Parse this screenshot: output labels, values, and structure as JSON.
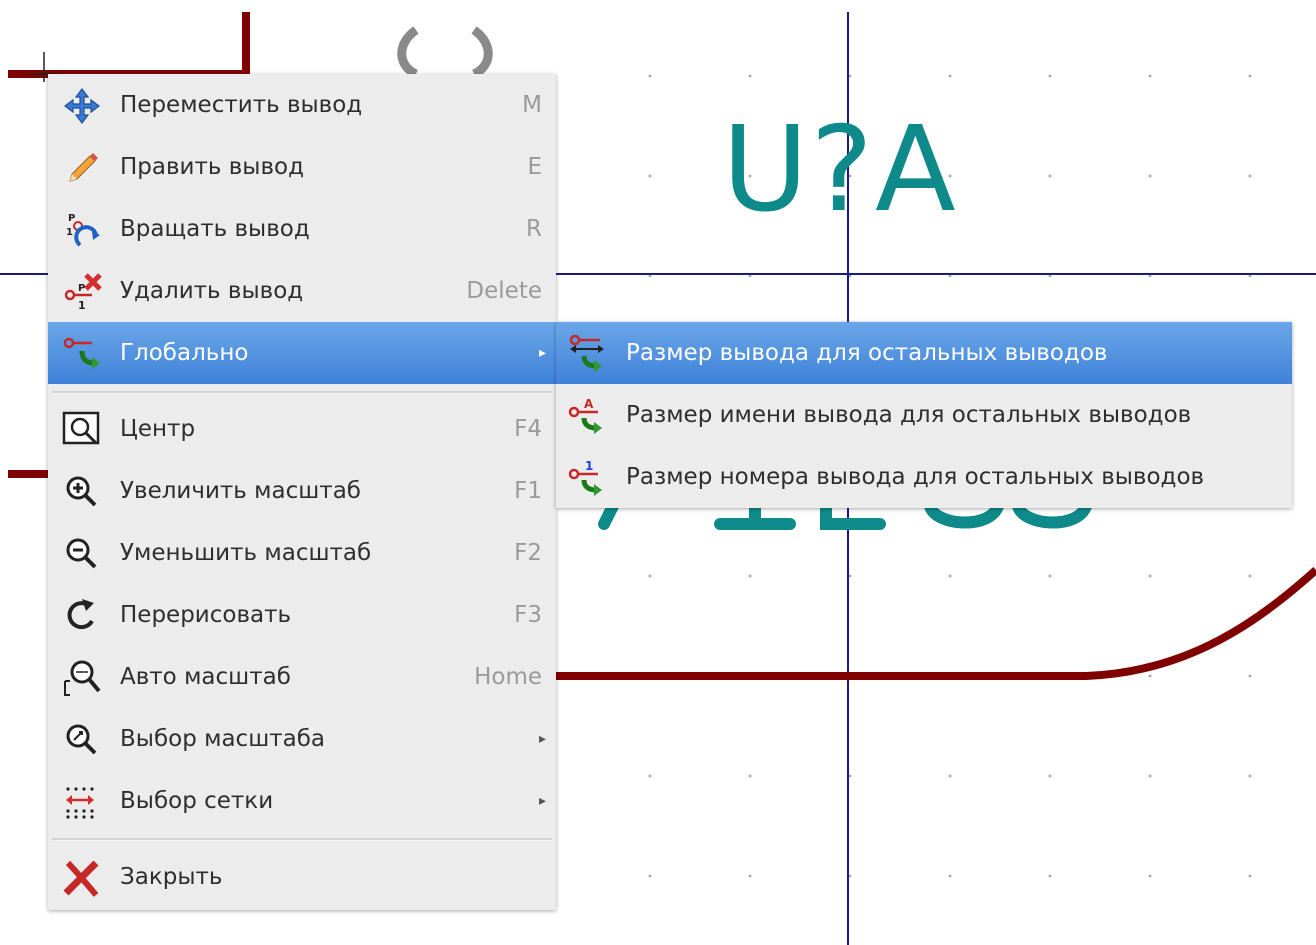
{
  "editor": {
    "reference_text": "U?A",
    "colors": {
      "grid_line": "#1a1a8c",
      "wire": "#800000",
      "ref_text": "#0f8a8a",
      "menu_bg": "#ececec",
      "highlight": "#4a8fe0"
    }
  },
  "context_menu": {
    "items": [
      {
        "label": "Переместить вывод",
        "shortcut": "M",
        "icon": "move-icon"
      },
      {
        "label": "Править вывод",
        "shortcut": "E",
        "icon": "pencil-icon"
      },
      {
        "label": "Вращать вывод",
        "shortcut": "R",
        "icon": "rotate-pin-icon"
      },
      {
        "label": "Удалить вывод",
        "shortcut": "Delete",
        "icon": "delete-pin-icon"
      },
      {
        "label": "Глобально",
        "shortcut": "",
        "icon": "global-pin-icon",
        "submenu": true,
        "active": true
      },
      {
        "label": "Центр",
        "shortcut": "F4",
        "icon": "zoom-center-icon"
      },
      {
        "label": "Увеличить масштаб",
        "shortcut": "F1",
        "icon": "zoom-in-icon"
      },
      {
        "label": "Уменьшить масштаб",
        "shortcut": "F2",
        "icon": "zoom-out-icon"
      },
      {
        "label": "Перерисовать",
        "shortcut": "F3",
        "icon": "redraw-icon"
      },
      {
        "label": "Авто масштаб",
        "shortcut": "Home",
        "icon": "zoom-fit-icon"
      },
      {
        "label": "Выбор масштаба",
        "shortcut": "",
        "icon": "zoom-select-icon",
        "submenu": true
      },
      {
        "label": "Выбор сетки",
        "shortcut": "",
        "icon": "grid-select-icon",
        "submenu": true
      },
      {
        "label": "Закрыть",
        "shortcut": "",
        "icon": "close-icon"
      }
    ]
  },
  "global_submenu": {
    "items": [
      {
        "label": "Размер вывода для остальных выводов",
        "icon": "pin-size-icon",
        "active": true
      },
      {
        "label": "Размер имени вывода для остальных выводов",
        "icon": "pin-name-size-icon"
      },
      {
        "label": "Размер номера вывода для остальных выводов",
        "icon": "pin-number-size-icon"
      }
    ]
  }
}
